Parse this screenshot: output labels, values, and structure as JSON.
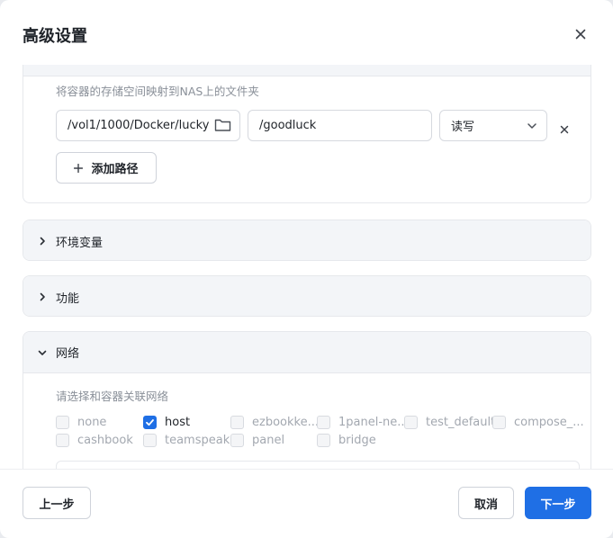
{
  "dialog": {
    "title": "高级设置"
  },
  "storage": {
    "hint": "将容器的存储空间映射到NAS上的文件夹",
    "host_path": "/vol1/1000/Docker/lucky",
    "container_path": "/goodluck",
    "mode": "读写",
    "add_path_label": "添加路径"
  },
  "sections": {
    "env": "环境变量",
    "features": "功能",
    "network": "网络"
  },
  "network": {
    "hint": "请选择和容器关联网络",
    "options": [
      {
        "label": "none",
        "checked": false
      },
      {
        "label": "host",
        "checked": true
      },
      {
        "label": "ezbookke...",
        "checked": false
      },
      {
        "label": "1panel-ne...",
        "checked": false
      },
      {
        "label": "test_default",
        "checked": false
      },
      {
        "label": "compose_...",
        "checked": false
      },
      {
        "label": "cashbook",
        "checked": false
      },
      {
        "label": "teamspeak",
        "checked": false
      },
      {
        "label": "panel",
        "checked": false
      },
      {
        "label": "bridge",
        "checked": false
      }
    ]
  },
  "footer": {
    "prev_label": "上一步",
    "cancel_label": "取消",
    "next_label": "下一步"
  },
  "colors": {
    "accent": "#1f6fe5",
    "panel_header": "#f3f5f8"
  }
}
